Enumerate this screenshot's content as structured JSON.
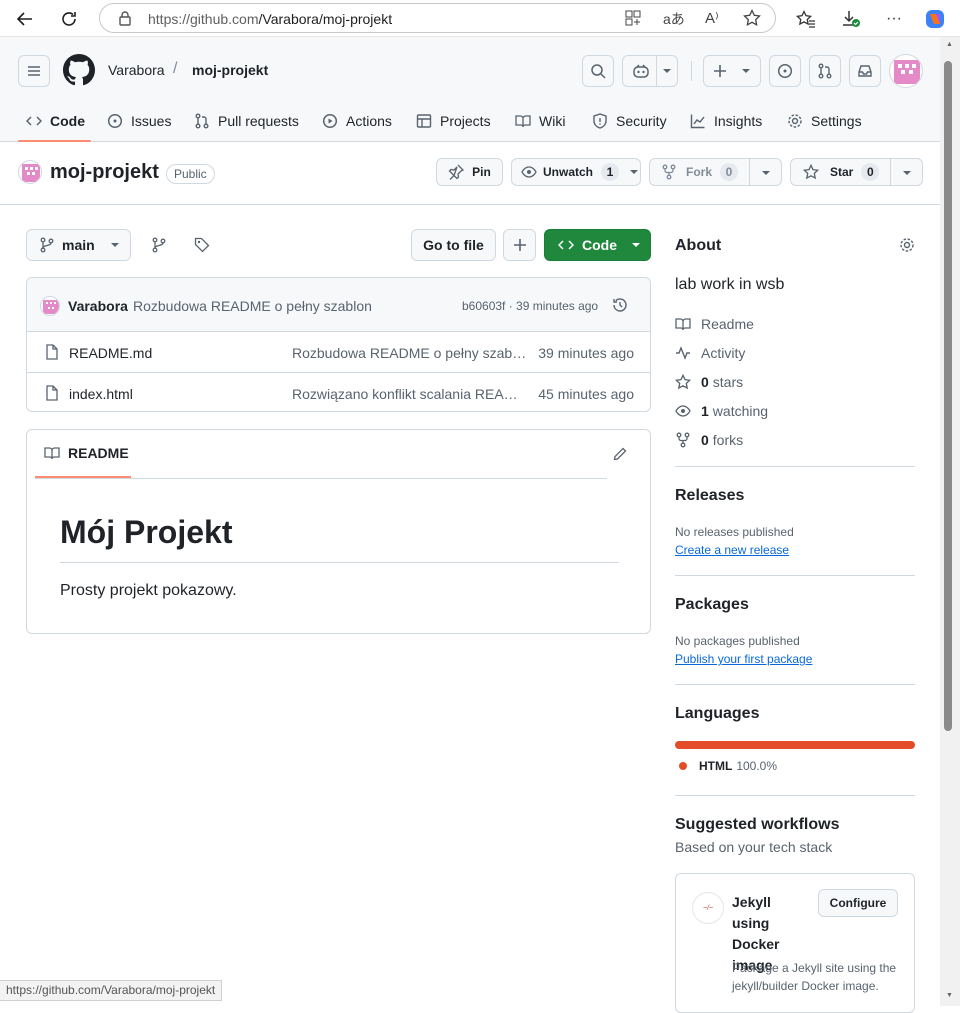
{
  "browser": {
    "url_host": "https://github.com",
    "url_path": "/Varabora/moj-projekt",
    "status_url": "https://github.com/Varabora/moj-projekt"
  },
  "header": {
    "owner": "Varabora",
    "separator": "/",
    "repo": "moj-projekt"
  },
  "tabs": [
    {
      "label": "Code",
      "icon": "code-icon",
      "active": true
    },
    {
      "label": "Issues",
      "icon": "issue-icon"
    },
    {
      "label": "Pull requests",
      "icon": "pull-request-icon"
    },
    {
      "label": "Actions",
      "icon": "play-icon"
    },
    {
      "label": "Projects",
      "icon": "table-icon"
    },
    {
      "label": "Wiki",
      "icon": "book-icon"
    },
    {
      "label": "Security",
      "icon": "shield-icon"
    },
    {
      "label": "Insights",
      "icon": "graph-icon"
    },
    {
      "label": "Settings",
      "icon": "gear-icon"
    }
  ],
  "repo": {
    "name": "moj-projekt",
    "visibility": "Public",
    "pin_label": "Pin",
    "unwatch_label": "Unwatch",
    "watch_count": "1",
    "fork_label": "Fork",
    "fork_count": "0",
    "star_label": "Star",
    "star_count": "0"
  },
  "toolbar": {
    "branch": "main",
    "go_to_file": "Go to file",
    "code_label": "Code",
    "accent": "#1f883d"
  },
  "commit": {
    "author": "Varabora",
    "message": "Rozbudowa README o pełny szablon",
    "hash_time": "b60603f · 39 minutes ago"
  },
  "files": [
    {
      "name": "README.md",
      "message": "Rozbudowa README o pełny szab…",
      "time": "39 minutes ago"
    },
    {
      "name": "index.html",
      "message": "Rozwiązano konflikt scalania REA…",
      "time": "45 minutes ago"
    }
  ],
  "readme": {
    "tab_label": "README",
    "heading": "Mój Projekt",
    "body": "Prosty projekt pokazowy."
  },
  "about": {
    "title": "About",
    "description": "lab work in wsb",
    "readme": "Readme",
    "activity": "Activity",
    "stars_count": "0",
    "stars_label": "stars",
    "watching_count": "1",
    "watching_label": "watching",
    "forks_count": "0",
    "forks_label": "forks"
  },
  "releases": {
    "title": "Releases",
    "text": "No releases published",
    "link": "Create a new release"
  },
  "packages": {
    "title": "Packages",
    "text": "No packages published",
    "link": "Publish your first package"
  },
  "languages": {
    "title": "Languages",
    "name": "HTML",
    "percent": "100.0%",
    "color": "#e34c26"
  },
  "workflows": {
    "title": "Suggested workflows",
    "subtitle": "Based on your tech stack",
    "card_title": "Jekyll using Docker image",
    "configure": "Configure",
    "card_desc": "Package a Jekyll site using the jekyll/builder Docker image."
  }
}
